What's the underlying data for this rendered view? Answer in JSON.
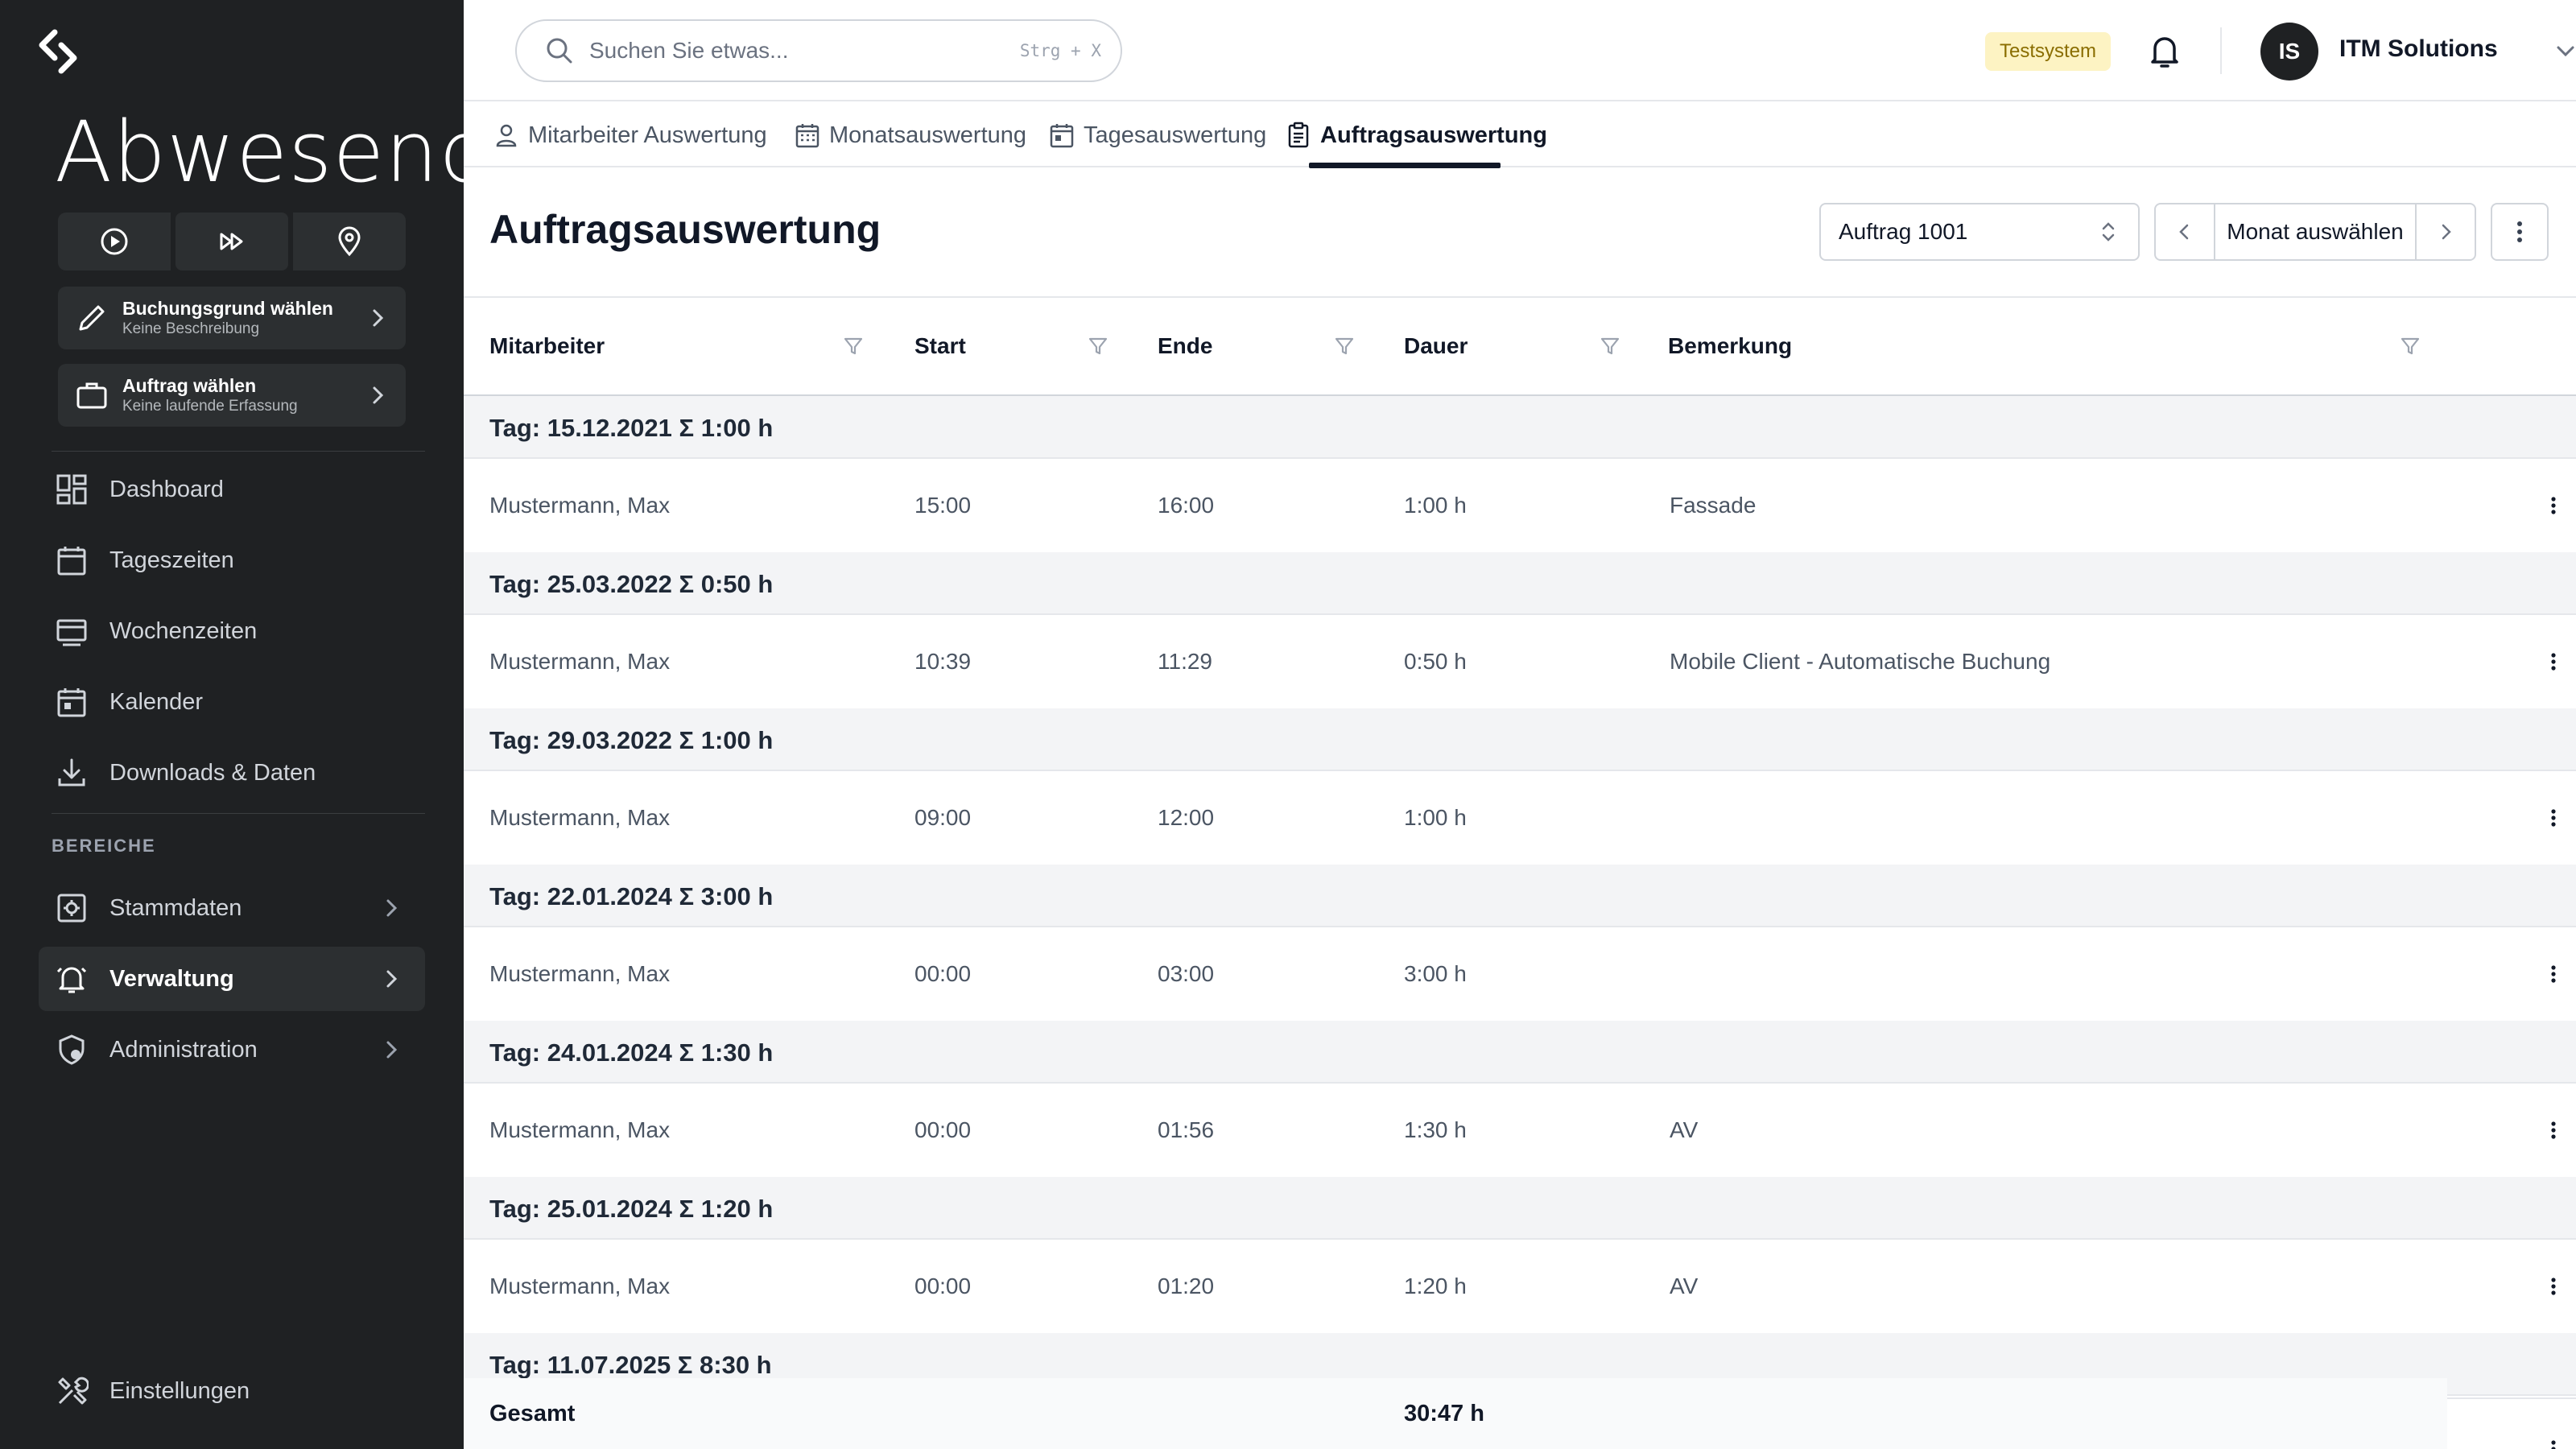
{
  "sidebar": {
    "status_title": "Abwesend",
    "booking_reason": {
      "title": "Buchungsgrund wählen",
      "subtitle": "Keine Beschreibung"
    },
    "order": {
      "title": "Auftrag wählen",
      "subtitle": "Keine laufende Erfassung"
    },
    "nav": [
      {
        "label": "Dashboard",
        "icon": "dashboard-icon"
      },
      {
        "label": "Tageszeiten",
        "icon": "calendar-blank-icon"
      },
      {
        "label": "Wochenzeiten",
        "icon": "week-view-icon"
      },
      {
        "label": "Kalender",
        "icon": "calendar-event-icon"
      },
      {
        "label": "Downloads & Daten",
        "icon": "download-icon"
      }
    ],
    "section_label": "BEREICHE",
    "areas": [
      {
        "label": "Stammdaten",
        "icon": "settings-box-icon"
      },
      {
        "label": "Verwaltung",
        "icon": "bell-alert-icon",
        "active": true
      },
      {
        "label": "Administration",
        "icon": "shield-user-icon"
      }
    ],
    "settings_label": "Einstellungen"
  },
  "topbar": {
    "search_placeholder": "Suchen Sie etwas...",
    "search_shortcut": "Strg + X",
    "env_badge": "Testsystem",
    "avatar_initials": "IS",
    "company": "ITM Solutions"
  },
  "tabs": [
    {
      "label": "Mitarbeiter Auswertung",
      "icon": "user-icon"
    },
    {
      "label": "Monatsauswertung",
      "icon": "calendar-month-icon"
    },
    {
      "label": "Tagesauswertung",
      "icon": "calendar-day-icon"
    },
    {
      "label": "Auftragsauswertung",
      "icon": "clipboard-icon",
      "active": true
    }
  ],
  "page": {
    "title": "Auftragsauswertung",
    "order_select": "Auftrag 1001",
    "month_select": "Monat auswählen"
  },
  "table": {
    "columns": [
      "Mitarbeiter",
      "Start",
      "Ende",
      "Dauer",
      "Bemerkung"
    ],
    "groups": [
      {
        "label": "Tag: 15.12.2021 Σ 1:00 h",
        "rows": [
          {
            "employee": "Mustermann, Max",
            "start": "15:00",
            "end": "16:00",
            "duration": "1:00 h",
            "remark": "Fassade"
          }
        ]
      },
      {
        "label": "Tag: 25.03.2022 Σ 0:50 h",
        "rows": [
          {
            "employee": "Mustermann, Max",
            "start": "10:39",
            "end": "11:29",
            "duration": "0:50 h",
            "remark": "Mobile Client - Automatische Buchung"
          }
        ]
      },
      {
        "label": "Tag: 29.03.2022 Σ 1:00 h",
        "rows": [
          {
            "employee": "Mustermann, Max",
            "start": "09:00",
            "end": "12:00",
            "duration": "1:00 h",
            "remark": ""
          }
        ]
      },
      {
        "label": "Tag: 22.01.2024 Σ 3:00 h",
        "rows": [
          {
            "employee": "Mustermann, Max",
            "start": "00:00",
            "end": "03:00",
            "duration": "3:00 h",
            "remark": ""
          }
        ]
      },
      {
        "label": "Tag: 24.01.2024 Σ 1:30 h",
        "rows": [
          {
            "employee": "Mustermann, Max",
            "start": "00:00",
            "end": "01:56",
            "duration": "1:30 h",
            "remark": "AV"
          }
        ]
      },
      {
        "label": "Tag: 25.01.2024 Σ 1:20 h",
        "rows": [
          {
            "employee": "Mustermann, Max",
            "start": "00:00",
            "end": "01:20",
            "duration": "1:20 h",
            "remark": "AV"
          }
        ]
      },
      {
        "label": "Tag: 11.07.2025 Σ 8:30 h",
        "rows": []
      }
    ],
    "total_label": "Gesamt",
    "total_duration": "30:47 h"
  },
  "colors": {
    "sidebar_bg": "#1f2123",
    "sidebar_card": "#2c2f31",
    "badge_bg": "#fdf3c3",
    "group_row_bg": "#f3f4f6"
  }
}
